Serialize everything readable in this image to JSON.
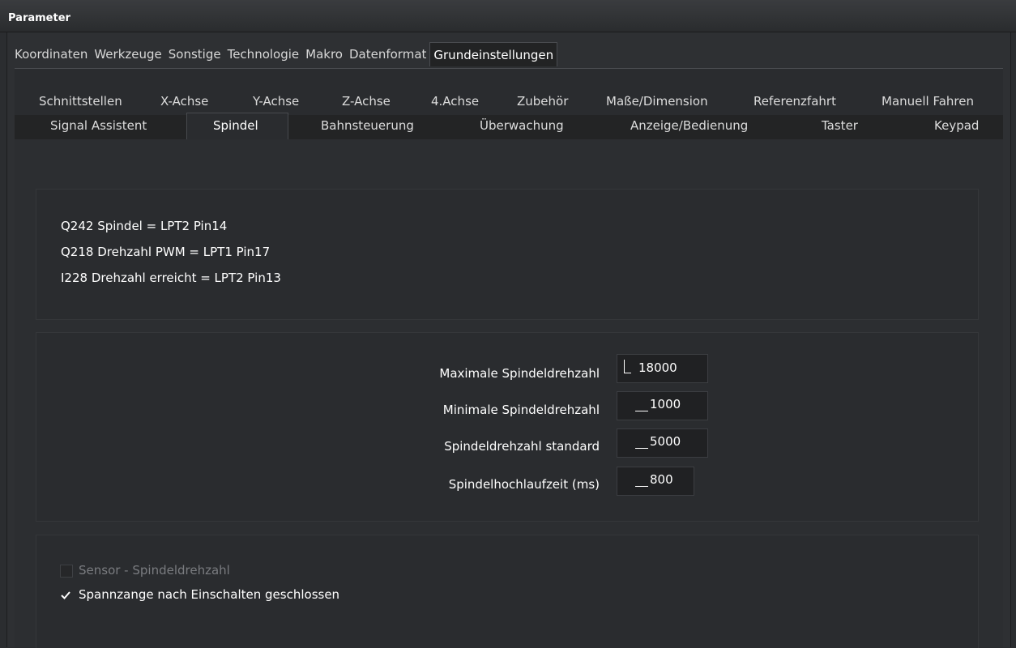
{
  "window": {
    "title": "Parameter"
  },
  "main_tabs": [
    {
      "label": "Koordinaten"
    },
    {
      "label": "Werkzeuge"
    },
    {
      "label": "Sonstige"
    },
    {
      "label": "Technologie"
    },
    {
      "label": "Makro"
    },
    {
      "label": "Datenformat"
    },
    {
      "label": "Grundeinstellungen",
      "active": true
    }
  ],
  "sub_tabs_row1": [
    {
      "label": "Schnittstellen"
    },
    {
      "label": "X-Achse"
    },
    {
      "label": "Y-Achse"
    },
    {
      "label": "Z-Achse"
    },
    {
      "label": "4.Achse"
    },
    {
      "label": "Zubehör"
    },
    {
      "label": "Maße/Dimension"
    },
    {
      "label": "Referenzfahrt"
    },
    {
      "label": "Manuell Fahren"
    }
  ],
  "sub_tabs_row2": [
    {
      "label": "Signal Assistent"
    },
    {
      "label": "Spindel",
      "active": true
    },
    {
      "label": "Bahnsteuerung"
    },
    {
      "label": "Überwachung"
    },
    {
      "label": "Anzeige/Bedienung"
    },
    {
      "label": "Taster"
    },
    {
      "label": "Keypad"
    }
  ],
  "signals": [
    "Q242 Spindel = LPT2 Pin14",
    "Q218 Drehzahl PWM = LPT1 Pin17",
    "I228 Drehzahl erreicht = LPT2 Pin13"
  ],
  "fields": [
    {
      "label": "Maximale Spindeldrehzahl",
      "value": "18000"
    },
    {
      "label": "Minimale Spindeldrehzahl",
      "value": "1000"
    },
    {
      "label": "Spindeldrehzahl standard",
      "value": "5000"
    },
    {
      "label": "Spindelhochlaufzeit (ms)",
      "value": "800"
    }
  ],
  "checkboxes": [
    {
      "label": "Sensor - Spindeldrehzahl",
      "checked": false,
      "enabled": false
    },
    {
      "label": "Spannzange nach Einschalten geschlossen",
      "checked": true,
      "enabled": true
    }
  ],
  "colors": {
    "background": "#2b2d30",
    "text": "#ffffff",
    "disabled_text": "#7a7c80"
  }
}
